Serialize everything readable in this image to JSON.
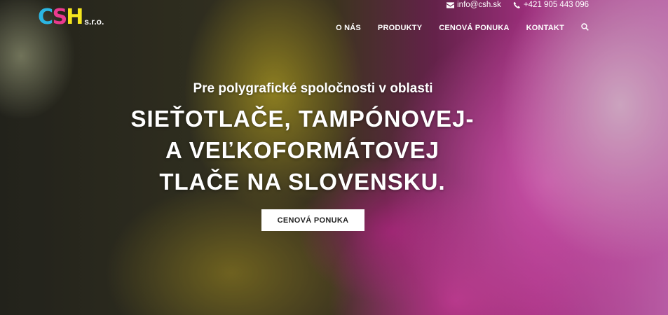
{
  "logo": {
    "main": "CSH",
    "sub": "s.r.o."
  },
  "contact": {
    "email": "info@csh.sk",
    "phone": "+421 905 443 096"
  },
  "nav": {
    "items": [
      "O NÁS",
      "PRODUKTY",
      "CENOVÁ PONUKA",
      "KONTAKT"
    ],
    "search_icon": "search-icon"
  },
  "hero": {
    "subtitle": "Pre polygrafické spoločnosti v oblasti",
    "title": "SIEŤOTLAČE, TAMPÓNOVEJ- A VEĽKOFORMÁTOVEJ TLAČE NA SLOVENSKU.",
    "cta": "CENOVÁ PONUKA"
  },
  "colors": {
    "logo_c": "#2bb6e3",
    "logo_s": "#ea3a8f",
    "logo_h": "#f5e61e",
    "powder": "#e64bb8"
  }
}
